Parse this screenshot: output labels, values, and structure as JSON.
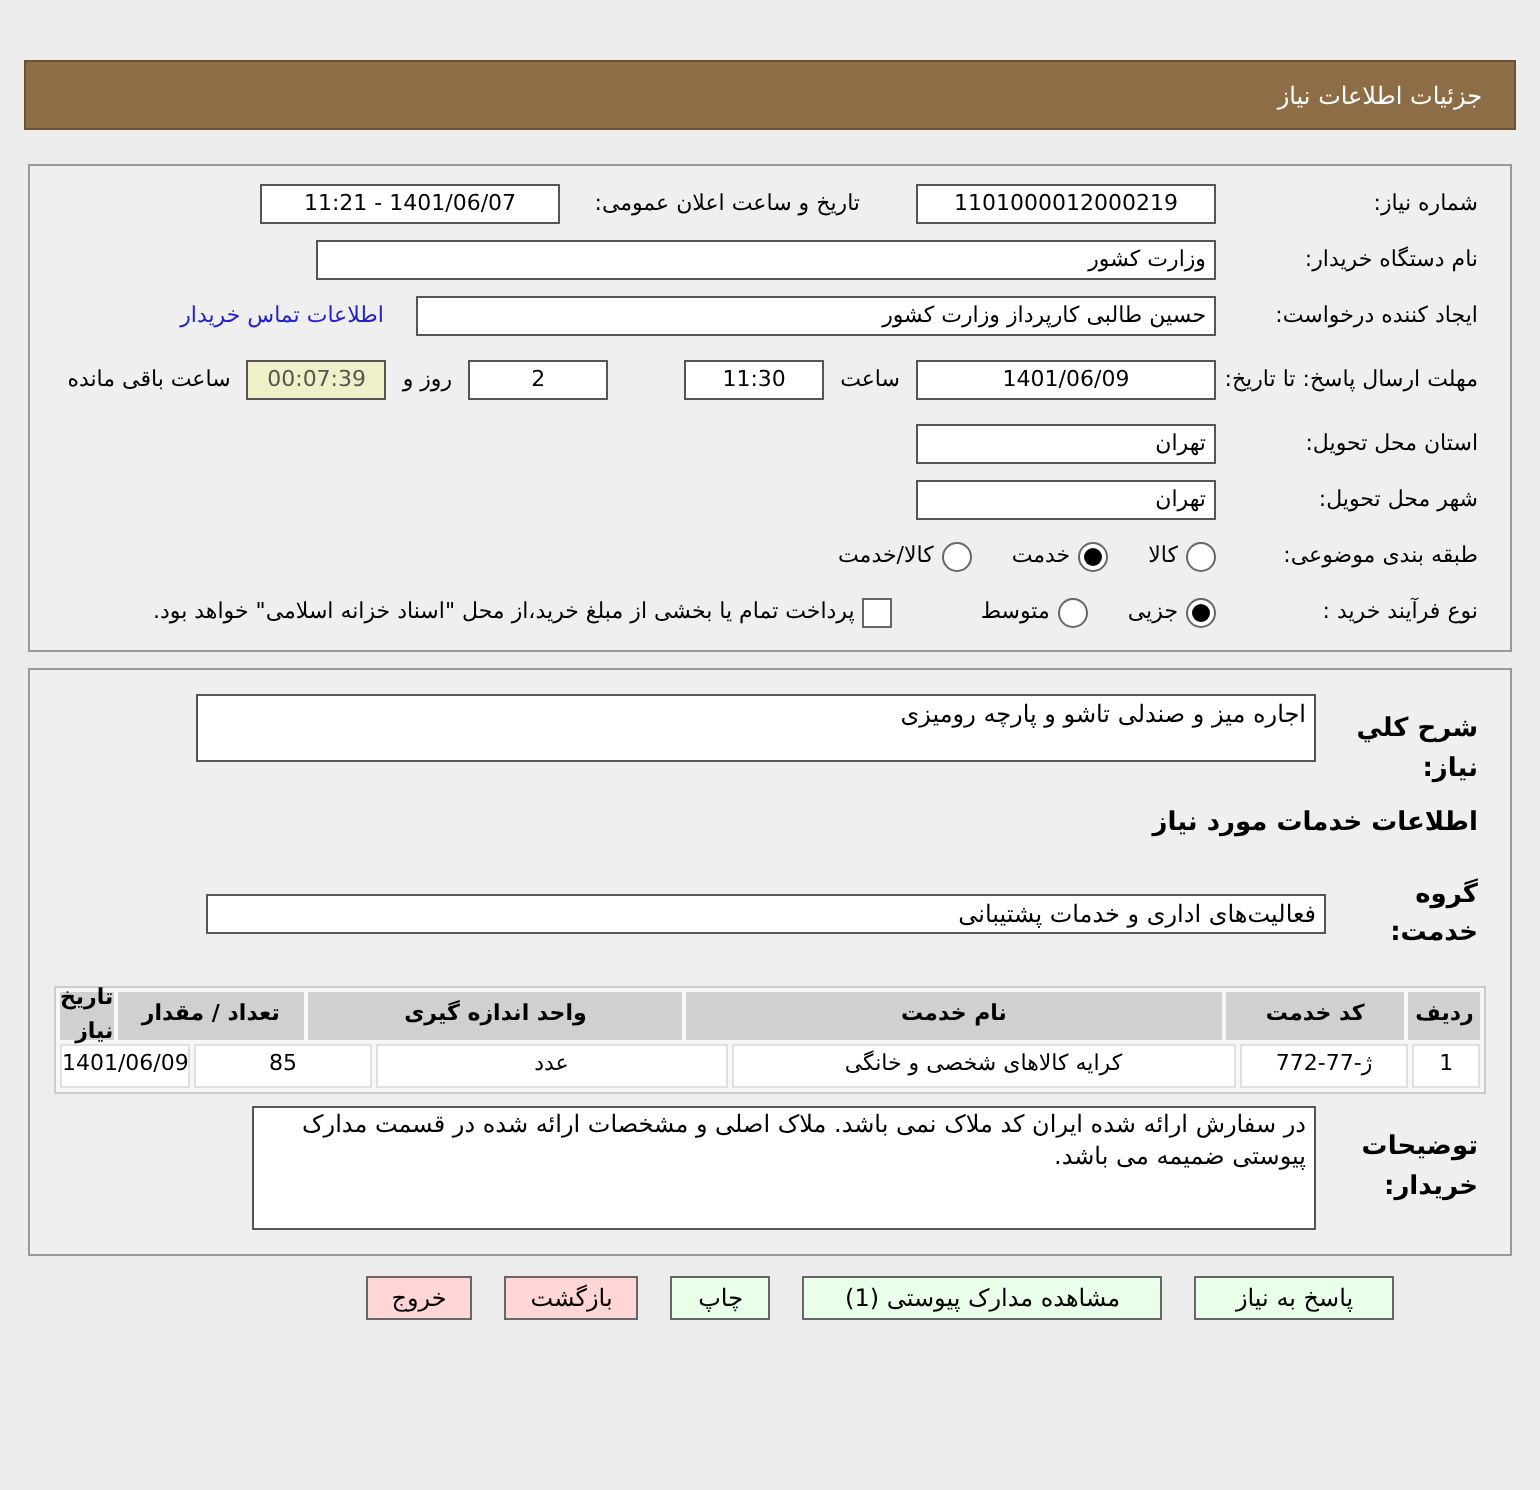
{
  "header": {
    "title": "جزئیات اطلاعات نیاز"
  },
  "details": {
    "need_number": {
      "label": "شماره نیاز:",
      "value": "1101000012000219"
    },
    "announce_date": {
      "label": "تاریخ و ساعت اعلان عمومی:",
      "value": "1401/06/07 - 11:21"
    },
    "buyer_org": {
      "label": "نام دستگاه خریدار:",
      "value": "وزارت کشور"
    },
    "requester": {
      "label": "ایجاد کننده درخواست:",
      "value": "حسین طالبی کارپرداز وزارت کشور"
    },
    "contact_link": "اطلاعات تماس خریدار",
    "deadline": {
      "label": "مهلت ارسال پاسخ: تا تاریخ:",
      "date": "1401/06/09",
      "time_label": "ساعت",
      "time": "11:30",
      "days": "2",
      "days_label": "روز و",
      "remaining": "00:07:39",
      "remaining_label": "ساعت باقی مانده"
    },
    "province": {
      "label": "استان محل تحویل:",
      "value": "تهران"
    },
    "city": {
      "label": "شهر محل تحویل:",
      "value": "تهران"
    },
    "category": {
      "label": "طبقه بندی موضوعی:",
      "options": [
        {
          "label": "کالا",
          "selected": false
        },
        {
          "label": "خدمت",
          "selected": true
        },
        {
          "label": "کالا/خدمت",
          "selected": false
        }
      ]
    },
    "process": {
      "label": "نوع فرآیند خرید :",
      "options": [
        {
          "label": "جزیی",
          "selected": true
        },
        {
          "label": "متوسط",
          "selected": false
        }
      ],
      "payment": {
        "label": "پرداخت تمام یا بخشی از مبلغ خرید،از محل \"اسناد خزانه اسلامی\" خواهد بود.",
        "checked": false
      }
    }
  },
  "need": {
    "summary": {
      "label": "شرح کلي نياز:",
      "value": "اجاره میز و صندلی تاشو و پارچه رومیزی"
    },
    "section_title": "اطلاعات خدمات مورد نیاز",
    "service_group": {
      "label": "گروه خدمت:",
      "value": "فعالیت‌های اداری و خدمات پشتیبانی"
    },
    "table": {
      "columns": [
        "ردیف",
        "کد خدمت",
        "نام خدمت",
        "واحد اندازه گیری",
        "تعداد / مقدار",
        "تاریخ نیاز"
      ],
      "rows": [
        [
          "1",
          "ژ-77-772",
          "کرایه کالاهای شخصی و خانگی",
          "عدد",
          "85",
          "1401/06/09"
        ]
      ]
    },
    "buyer_notes": {
      "label": "توضیحات خریدار:",
      "value": "در سفارش ارائه شده ایران کد ملاک نمی باشد. ملاک اصلی و مشخصات ارائه شده در قسمت مدارک پیوستی ضمیمه می باشد."
    }
  },
  "buttons": [
    {
      "label": "پاسخ به نیاز",
      "kind": "action"
    },
    {
      "label": "مشاهده مدارک پیوستی (1)",
      "kind": "action"
    },
    {
      "label": "چاپ",
      "kind": "action"
    },
    {
      "label": "بازگشت",
      "kind": "exit"
    },
    {
      "label": "خروج",
      "kind": "exit"
    }
  ]
}
